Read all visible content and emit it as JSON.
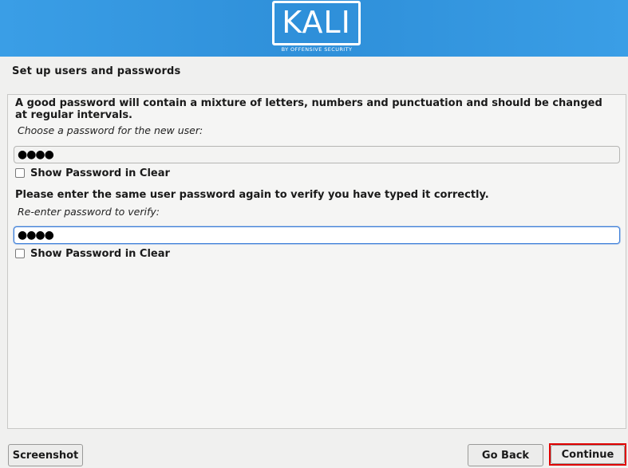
{
  "banner": {
    "logo_text": "KALI",
    "logo_tagline": "BY OFFENSIVE SECURITY",
    "background_color": "#2e8fd9"
  },
  "page": {
    "title": "Set up users and passwords"
  },
  "form": {
    "intro": "A good password will contain a mixture of letters, numbers and punctuation and should be changed at regular intervals.",
    "password_label": "Choose a password for the new user:",
    "password_value": "●●●●",
    "show_password_label": "Show Password in Clear",
    "verify_text": "Please enter the same user password again to verify you have typed it correctly.",
    "verify_label": "Re-enter password to verify:",
    "verify_value": "●●●●",
    "show_verify_label": "Show Password in Clear"
  },
  "footer": {
    "screenshot_label": "Screenshot",
    "back_label": "Go Back",
    "continue_label": "Continue",
    "highlight_color": "#e00000"
  }
}
